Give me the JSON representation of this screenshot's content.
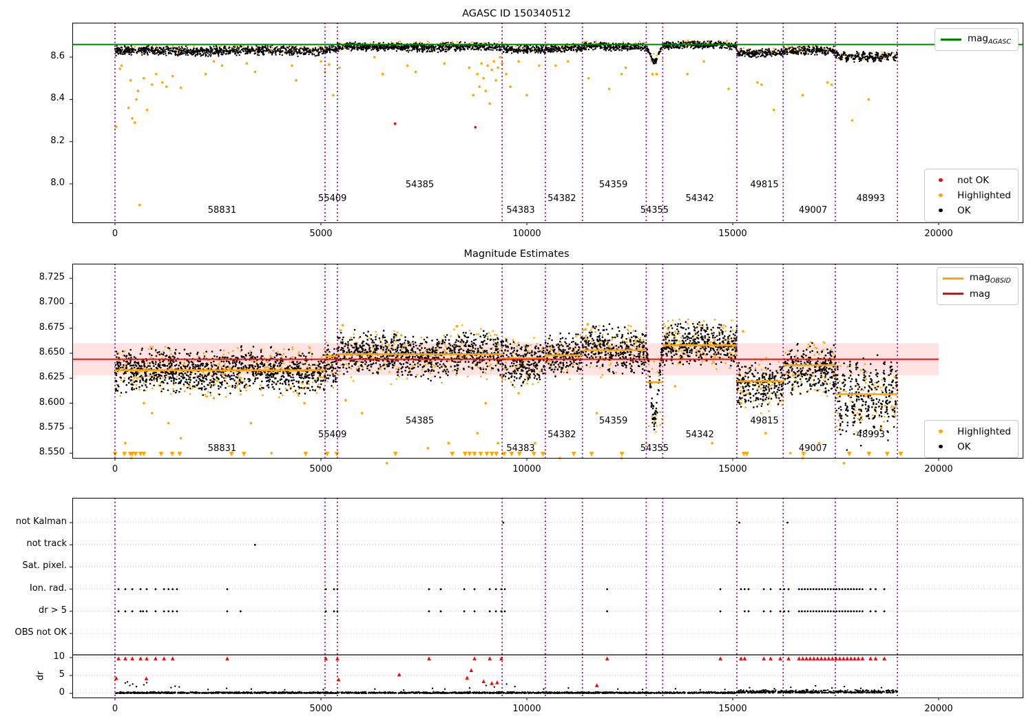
{
  "title_top": "AGASC ID 150340512",
  "title_middle": "Magnitude Estimates",
  "colors": {
    "ok": "#000000",
    "highlighted": "#ffa500",
    "not_ok": "#ff0000",
    "mag_agasc": "#008000",
    "mag": "#ff0000",
    "mag_obsid": "#ffa500",
    "boundary": "#8f008f",
    "mag_band_fill": "rgba(255,0,0,0.11)",
    "grid": "#bdbdbd"
  },
  "x_axis": {
    "ticks": [
      0,
      5000,
      10000,
      15000,
      20000
    ],
    "labels": [
      "0",
      "5000",
      "10000",
      "15000",
      "20000"
    ],
    "lim": [
      -1040,
      22040
    ]
  },
  "obsid_boundaries": [
    0,
    5100,
    5400,
    9400,
    10450,
    11350,
    12900,
    13300,
    15100,
    16225,
    17490,
    19000
  ],
  "obsids": [
    {
      "obsid": "58831",
      "x0": 0,
      "x1": 5100,
      "label_x": 2600,
      "stagger": 0,
      "top_mean": 8.63,
      "top_spread": 0.022,
      "mid_mean": 8.6325,
      "mid_spread": 0.021,
      "mag_obsid": 8.633
    },
    {
      "obsid": "55409",
      "x0": 5100,
      "x1": 5400,
      "label_x": 5280,
      "stagger": 1,
      "top_mean": 8.636,
      "top_spread": 0.02,
      "mid_mean": 8.638,
      "mid_spread": 0.021,
      "mag_obsid": 8.647
    },
    {
      "obsid": "54385",
      "x0": 5400,
      "x1": 9400,
      "label_x": 7400,
      "stagger": 2,
      "top_mean": 8.6475,
      "top_spread": 0.02,
      "mid_mean": 8.6485,
      "mid_spread": 0.021,
      "mag_obsid": 8.649
    },
    {
      "obsid": "54383",
      "x0": 9400,
      "x1": 10450,
      "label_x": 9850,
      "stagger": 0,
      "top_mean": 8.639,
      "top_spread": 0.021,
      "mid_mean": 8.643,
      "mid_spread": 0.021,
      "mag_obsid": 8.645
    },
    {
      "obsid": "54382",
      "x0": 10450,
      "x1": 11350,
      "label_x": 10850,
      "stagger": 1,
      "top_mean": 8.642,
      "top_spread": 0.019,
      "mid_mean": 8.6475,
      "mid_spread": 0.02,
      "mag_obsid": 8.648
    },
    {
      "obsid": "54359",
      "x0": 11350,
      "x1": 12900,
      "label_x": 12100,
      "stagger": 2,
      "top_mean": 8.6495,
      "top_spread": 0.019,
      "mid_mean": 8.654,
      "mid_spread": 0.022,
      "mag_obsid": 8.653
    },
    {
      "obsid": "54355",
      "x0": 12900,
      "x1": 13300,
      "label_x": 13100,
      "stagger": 0,
      "dip": true,
      "top_min": 8.578,
      "mid_min": 8.582,
      "top_spread": 0.011,
      "mid_spread": 0.012,
      "mag_obsid": 8.621
    },
    {
      "obsid": "54342",
      "x0": 13300,
      "x1": 15100,
      "label_x": 14200,
      "stagger": 1,
      "top_mean": 8.656,
      "top_spread": 0.017,
      "mid_mean": 8.6575,
      "mid_spread": 0.02,
      "mag_obsid": 8.658
    },
    {
      "obsid": "49815",
      "x0": 15100,
      "x1": 16225,
      "label_x": 15770,
      "stagger": 2,
      "top_mean": 8.621,
      "top_spread": 0.019,
      "mid_mean": 8.62,
      "mid_spread": 0.022,
      "mag_obsid": 8.622
    },
    {
      "obsid": "49007",
      "x0": 16225,
      "x1": 17490,
      "label_x": 16950,
      "stagger": 0,
      "top_mean": 8.6275,
      "top_spread": 0.02,
      "mid_mean": 8.632,
      "mid_spread": 0.024,
      "mag_obsid": 8.638
    },
    {
      "obsid": "48993",
      "x0": 17490,
      "x1": 19000,
      "label_x": 18350,
      "stagger": 1,
      "osc": true,
      "top_mean": 8.604,
      "top_spread": 0.016,
      "mid_mean": 8.61,
      "mid_spread": 0.022,
      "mag_obsid": 8.609
    }
  ],
  "chart_data": [
    {
      "id": "top",
      "type": "scatter",
      "title": "AGASC ID 150340512",
      "ylim": [
        7.82,
        8.76
      ],
      "yticks": [
        8.0,
        8.2,
        8.4,
        8.6
      ],
      "ytick_labels": [
        "8.0",
        "8.2",
        "8.4",
        "8.6"
      ],
      "mag_agasc": 8.66,
      "legend_upper": [
        {
          "marker": "line",
          "color": "#008000",
          "label": "mag",
          "sub": "AGASC"
        }
      ],
      "legend_lower": [
        {
          "marker": "dot",
          "color": "#ff0000",
          "label": "not OK"
        },
        {
          "marker": "dot",
          "color": "#ffa500",
          "label": "Highlighted"
        },
        {
          "marker": "dot",
          "color": "#000000",
          "label": "OK"
        }
      ],
      "not_ok_points": [
        [
          6800,
          8.285
        ],
        [
          8750,
          8.268
        ]
      ],
      "highlighted_outliers": [
        [
          30,
          8.27
        ],
        [
          120,
          8.545
        ],
        [
          160,
          8.56
        ],
        [
          330,
          8.36
        ],
        [
          380,
          8.49
        ],
        [
          420,
          8.31
        ],
        [
          480,
          8.29
        ],
        [
          520,
          8.4
        ],
        [
          560,
          8.44
        ],
        [
          600,
          7.9
        ],
        [
          700,
          8.5
        ],
        [
          780,
          8.35
        ],
        [
          900,
          8.47
        ],
        [
          1000,
          8.52
        ],
        [
          1150,
          8.48
        ],
        [
          1250,
          8.46
        ],
        [
          1400,
          8.51
        ],
        [
          1600,
          8.455
        ],
        [
          2200,
          8.52
        ],
        [
          2400,
          8.58
        ],
        [
          2600,
          8.56
        ],
        [
          3200,
          8.57
        ],
        [
          3400,
          8.53
        ],
        [
          4300,
          8.56
        ],
        [
          4400,
          8.49
        ],
        [
          5000,
          8.58
        ],
        [
          5100,
          8.53
        ],
        [
          5200,
          8.565
        ],
        [
          5300,
          8.42
        ],
        [
          5450,
          8.55
        ],
        [
          6300,
          8.6
        ],
        [
          6500,
          8.52
        ],
        [
          7100,
          8.56
        ],
        [
          7300,
          8.53
        ],
        [
          8000,
          8.57
        ],
        [
          8600,
          8.55
        ],
        [
          8700,
          8.42
        ],
        [
          8800,
          8.52
        ],
        [
          8850,
          8.46
        ],
        [
          8900,
          8.57
        ],
        [
          8950,
          8.5
        ],
        [
          9000,
          8.44
        ],
        [
          9050,
          8.56
        ],
        [
          9100,
          8.38
        ],
        [
          9150,
          8.54
        ],
        [
          9200,
          8.58
        ],
        [
          9250,
          8.49
        ],
        [
          9300,
          8.55
        ],
        [
          9350,
          8.6
        ],
        [
          9400,
          8.57
        ],
        [
          9500,
          8.52
        ],
        [
          9600,
          8.46
        ],
        [
          9800,
          8.58
        ],
        [
          10000,
          8.42
        ],
        [
          10300,
          8.56
        ],
        [
          10700,
          8.56
        ],
        [
          11000,
          8.58
        ],
        [
          11500,
          8.5
        ],
        [
          12000,
          8.45
        ],
        [
          12300,
          8.52
        ],
        [
          12400,
          8.55
        ],
        [
          13050,
          8.52
        ],
        [
          13150,
          8.52
        ],
        [
          13900,
          8.52
        ],
        [
          14300,
          8.58
        ],
        [
          14900,
          8.45
        ],
        [
          15600,
          8.48
        ],
        [
          15700,
          8.47
        ],
        [
          16000,
          8.35
        ],
        [
          16700,
          8.42
        ],
        [
          17300,
          8.48
        ],
        [
          17400,
          8.47
        ],
        [
          17900,
          8.3
        ],
        [
          18300,
          8.4
        ]
      ]
    },
    {
      "id": "middle",
      "type": "scatter",
      "title": "Magnitude Estimates",
      "ylim": [
        8.545,
        8.74
      ],
      "yticks": [
        8.55,
        8.575,
        8.6,
        8.625,
        8.65,
        8.675,
        8.7,
        8.725
      ],
      "ytick_labels": [
        "8.550",
        "8.575",
        "8.600",
        "8.625",
        "8.650",
        "8.675",
        "8.700",
        "8.725"
      ],
      "mag": 8.644,
      "mag_band": [
        8.628,
        8.66
      ],
      "mag_line_end": 20000,
      "legend_upper": [
        {
          "marker": "line",
          "color": "#ffa500",
          "label": "mag",
          "sub": "OBSID"
        },
        {
          "marker": "line",
          "color": "#ff0000",
          "label": "mag",
          "sub": ""
        }
      ],
      "legend_lower": [
        {
          "marker": "dot",
          "color": "#ffa500",
          "label": "Highlighted"
        },
        {
          "marker": "dot",
          "color": "#000000",
          "label": "OK"
        }
      ],
      "highlighted_low": [
        [
          250,
          8.56
        ],
        [
          400,
          8.545
        ],
        [
          700,
          8.6
        ],
        [
          900,
          8.59
        ],
        [
          1300,
          8.58
        ],
        [
          1600,
          8.565
        ],
        [
          2400,
          8.605
        ],
        [
          3300,
          8.58
        ],
        [
          3800,
          8.55
        ],
        [
          4600,
          8.6
        ],
        [
          5600,
          8.603
        ],
        [
          6000,
          8.59
        ],
        [
          6600,
          8.54
        ],
        [
          7600,
          8.555
        ],
        [
          8100,
          8.56
        ],
        [
          8800,
          8.57
        ],
        [
          9000,
          8.6
        ],
        [
          9300,
          8.56
        ],
        [
          9800,
          8.61
        ],
        [
          10200,
          8.56
        ],
        [
          10800,
          8.545
        ],
        [
          11700,
          8.59
        ],
        [
          12300,
          8.545
        ],
        [
          12900,
          8.56
        ],
        [
          13600,
          8.617
        ],
        [
          14500,
          8.56
        ],
        [
          15200,
          8.6
        ],
        [
          15800,
          8.57
        ],
        [
          16400,
          8.55
        ],
        [
          16700,
          8.545
        ],
        [
          17100,
          8.56
        ],
        [
          17700,
          8.54
        ],
        [
          18300,
          8.55
        ],
        [
          18600,
          8.575
        ]
      ],
      "highlighted_high": [
        [
          5480,
          8.673
        ],
        [
          5530,
          8.678
        ],
        [
          6950,
          8.668
        ],
        [
          8300,
          8.677
        ],
        [
          11430,
          8.674
        ],
        [
          11480,
          8.679
        ],
        [
          12650,
          8.661
        ],
        [
          13380,
          8.668
        ],
        [
          13430,
          8.674
        ],
        [
          14200,
          8.678
        ],
        [
          15250,
          8.672
        ]
      ],
      "clipped_low_x": [
        0,
        230,
        370,
        420,
        500,
        620,
        700,
        1120,
        1390,
        1570,
        2830,
        3130,
        4630,
        5150,
        5385,
        6810,
        8190,
        8500,
        8610,
        8730,
        8880,
        9030,
        9150,
        9260,
        9450,
        9630,
        9820,
        10170,
        10390,
        11140,
        11570,
        12310,
        15270,
        15340,
        16720,
        17830,
        18310,
        18750,
        19080
      ]
    },
    {
      "id": "bottom",
      "type": "scatter",
      "rows": [
        "not Kalman",
        "not track",
        "Sat. pixel.",
        "Ion. rad.",
        "dr > 5",
        "OBS not OK"
      ],
      "dr": {
        "label": "dr",
        "ticks": [
          0,
          5,
          10
        ],
        "tick_labels": [
          "0",
          "5",
          "10"
        ],
        "cap_line": 10.8,
        "cap_value": 9.8
      },
      "flags": {
        "not_kalman": [
          9430,
          15160,
          16330
        ],
        "not_track": [
          3400
        ],
        "sat_pixel": [],
        "ion_rad": [
          85,
          250,
          420,
          620,
          770,
          985,
          1190,
          1300,
          1400,
          1505,
          2725,
          5120,
          5320,
          5400,
          7625,
          7910,
          8480,
          8730,
          9100,
          9250,
          9380,
          9465,
          11950,
          14700,
          15200,
          15290,
          15385,
          15755,
          15920,
          16155,
          16250,
          16355,
          16610,
          16680,
          16750,
          16820,
          16890,
          16960,
          17030,
          17100,
          17170,
          17240,
          17310,
          17380,
          17450,
          17520,
          17590,
          17660,
          17730,
          17800,
          17870,
          17940,
          18010,
          18080,
          18150,
          18345,
          18470,
          18680
        ],
        "dr_gt_5": [
          85,
          250,
          420,
          620,
          680,
          770,
          985,
          1190,
          1300,
          1400,
          1505,
          2725,
          3050,
          5120,
          5320,
          5400,
          7625,
          7910,
          8480,
          8730,
          9100,
          9250,
          9380,
          9465,
          11950,
          14700,
          15290,
          15385,
          15755,
          15920,
          16155,
          16250,
          16355,
          16610,
          16680,
          16750,
          16820,
          16890,
          16960,
          17030,
          17100,
          17170,
          17240,
          17310,
          17380,
          17450,
          17520,
          17590,
          17660,
          17730,
          17800,
          17870,
          17940,
          18010,
          18080,
          18150,
          18345,
          18470,
          18680
        ],
        "obs_not_ok": []
      },
      "dr_capped_x": [
        85,
        250,
        420,
        620,
        770,
        985,
        1190,
        1400,
        2725,
        5120,
        5400,
        7625,
        8730,
        9100,
        9380,
        11950,
        14700,
        15200,
        15290,
        15755,
        15920,
        16155,
        16355,
        16610,
        16700,
        16790,
        16880,
        16970,
        17060,
        17150,
        17240,
        17330,
        17420,
        17510,
        17600,
        17690,
        17780,
        17870,
        17960,
        18050,
        18150,
        18345,
        18470,
        18680
      ],
      "dr_red": [
        [
          30,
          4.3
        ],
        [
          760,
          4.2
        ],
        [
          5430,
          3.9
        ],
        [
          6900,
          5.3
        ],
        [
          8550,
          4.4
        ],
        [
          8650,
          6.5
        ],
        [
          8950,
          3.4
        ],
        [
          9150,
          2.9
        ],
        [
          9280,
          3.1
        ],
        [
          11700,
          2.3
        ]
      ],
      "dr_spikes": [
        [
          250,
          2.9
        ],
        [
          300,
          3.2
        ],
        [
          360,
          2.2
        ],
        [
          430,
          2.6
        ],
        [
          520,
          1.9
        ],
        [
          700,
          2.4
        ],
        [
          770,
          3.0
        ],
        [
          1360,
          1.6
        ],
        [
          1460,
          2.0
        ],
        [
          1560,
          1.8
        ],
        [
          2260,
          1.1
        ],
        [
          2710,
          1.4
        ],
        [
          3310,
          1.2
        ],
        [
          4120,
          1.0
        ],
        [
          5060,
          1.1
        ],
        [
          6310,
          1.2
        ],
        [
          7010,
          0.9
        ],
        [
          7710,
          1.4
        ],
        [
          8010,
          1.2
        ],
        [
          8610,
          1.5
        ],
        [
          9010,
          2.2
        ],
        [
          9210,
          1.8
        ],
        [
          9510,
          2.6
        ],
        [
          9710,
          1.9
        ],
        [
          10410,
          1.2
        ],
        [
          11010,
          1.5
        ],
        [
          12210,
          1.2
        ],
        [
          12810,
          1.1
        ],
        [
          13610,
          1.3
        ],
        [
          14210,
          1.0
        ],
        [
          14810,
          1.1
        ],
        [
          15410,
          1.6
        ],
        [
          16010,
          1.3
        ],
        [
          16410,
          1.7
        ],
        [
          17010,
          2.1
        ],
        [
          17410,
          1.5
        ],
        [
          17710,
          1.9
        ],
        [
          18110,
          1.4
        ],
        [
          18610,
          1.6
        ]
      ],
      "dr_baseline": {
        "x_range": [
          0,
          19000
        ],
        "typical": 0.3,
        "elevated_after": 15100,
        "elevated_typical": 0.6
      }
    }
  ]
}
